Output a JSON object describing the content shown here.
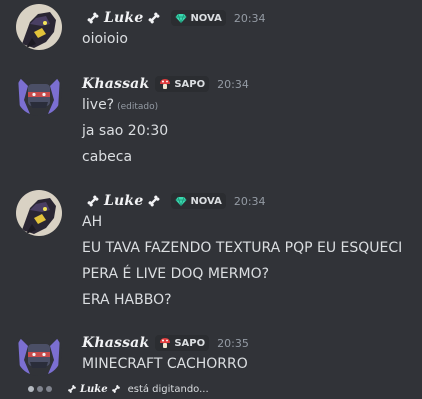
{
  "messages": [
    {
      "author": "Luke",
      "badge": {
        "label": "NOVA",
        "icon": "diamond-icon",
        "color": "#3ad9b0"
      },
      "time": "20:34",
      "lines": [
        "oioioio"
      ]
    },
    {
      "author": "Khassak",
      "badge": {
        "label": "SAPO",
        "icon": "mushroom-icon",
        "color": "#e74c3c"
      },
      "time": "20:34",
      "lines": [
        "live?",
        "ja sao 20:30",
        "cabeca"
      ],
      "edited_label": "(editado)"
    },
    {
      "author": "Luke",
      "badge": {
        "label": "NOVA",
        "icon": "diamond-icon",
        "color": "#3ad9b0"
      },
      "time": "20:34",
      "lines": [
        "AH",
        "EU TAVA FAZENDO TEXTURA PQP EU ESQUECI",
        "PERA É LIVE DOQ MERMO?",
        "ERA HABBO?"
      ]
    },
    {
      "author": "Khassak",
      "badge": {
        "label": "SAPO",
        "icon": "mushroom-icon",
        "color": "#e74c3c"
      },
      "time": "20:35",
      "lines": [
        "MINECRAFT CACHORRO"
      ]
    }
  ],
  "typing": {
    "name": "Luke",
    "text": "está digitando..."
  },
  "colors": {
    "background": "#313338",
    "text": "#dbdee1",
    "muted": "#949ba4"
  }
}
